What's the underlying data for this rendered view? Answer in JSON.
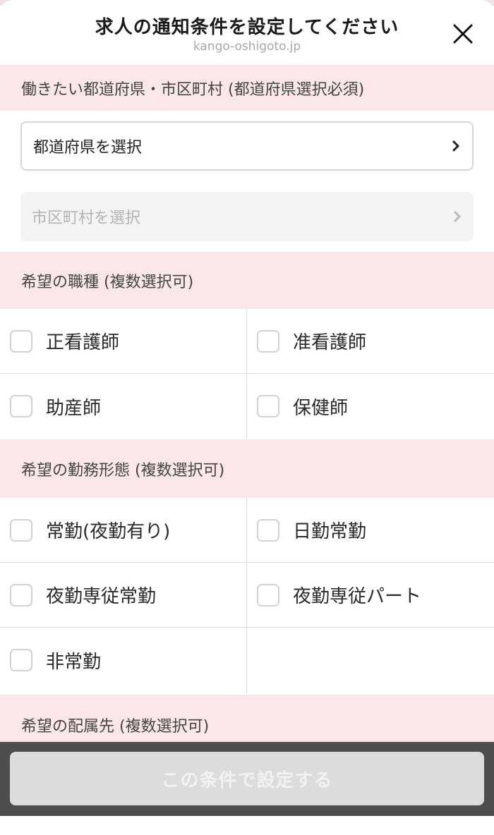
{
  "header": {
    "title": "求人の通知条件を設定してください",
    "url": "kango-oshigoto.jp"
  },
  "location": {
    "section_label": "働きたい都道府県・市区町村 (都道府県選択必須)",
    "prefecture_select": "都道府県を選択",
    "city_select": "市区町村を選択"
  },
  "job_type": {
    "section_label": "希望の職種 (複数選択可)",
    "options": [
      "正看護師",
      "准看護師",
      "助産師",
      "保健師"
    ]
  },
  "work_style": {
    "section_label": "希望の勤務形態 (複数選択可)",
    "options": [
      "常勤(夜勤有り)",
      "日勤常勤",
      "夜勤専従常勤",
      "夜勤専従パート",
      "非常勤"
    ]
  },
  "department": {
    "section_label": "希望の配属先 (複数選択可)"
  },
  "footer": {
    "submit_label": "この条件で設定する"
  },
  "colors": {
    "section_bg": "#fbe6ea",
    "footer_bar": "#4d4d4d",
    "button_disabled": "#dcdcdc"
  },
  "icons": {
    "close": "close-icon",
    "chevron": "chevron-right-icon"
  }
}
